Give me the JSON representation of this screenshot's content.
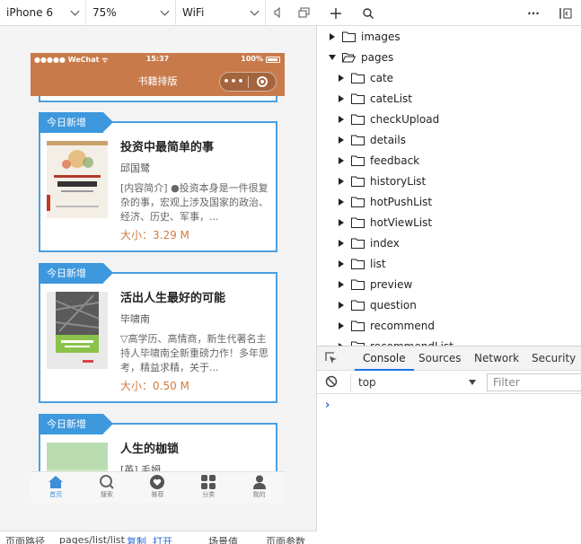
{
  "simulator": {
    "device": "iPhone 6",
    "zoom": "75%",
    "network": "WiFi"
  },
  "phone": {
    "status": {
      "carrier": "●●●●● WeChat ᯤ",
      "time": "15:37",
      "battery": "100%"
    },
    "nav_title": "书籍排版",
    "capsule_dots": "•••"
  },
  "cards": [
    {
      "tag": "今日新增",
      "title": "投资中最简单的事",
      "author": "邱国鹭",
      "desc": "[内容简介] ●投资本身是一件很复杂的事，宏观上涉及国家的政治、经济、历史、军事，...",
      "size": "大小：3.29 M"
    },
    {
      "tag": "今日新增",
      "title": "活出人生最好的可能",
      "author": "毕啸南",
      "desc": "▽高学历、高情商，新生代著名主持人毕啸南全新重磅力作！多年思考，精益求精，关于...",
      "size": "大小：0.50 M"
    },
    {
      "tag": "今日新增",
      "title": "人生的枷锁",
      "author": "[英] 毛姆",
      "desc": "",
      "size": ""
    }
  ],
  "tabbar": [
    {
      "label": "首页",
      "icon": "home-icon",
      "active": true
    },
    {
      "label": "搜索",
      "icon": "search-icon",
      "active": false
    },
    {
      "label": "推荐",
      "icon": "heart-icon",
      "active": false
    },
    {
      "label": "分类",
      "icon": "grid-icon",
      "active": false
    },
    {
      "label": "我的",
      "icon": "person-icon",
      "active": false
    }
  ],
  "bottom_bar": {
    "path_label": "页面路径",
    "path_value": "pages/list/list",
    "copy": "复制",
    "open": "打开",
    "scene": "场景值",
    "params": "页面参数"
  },
  "devtools": {
    "tree": [
      {
        "name": "images",
        "expanded": false,
        "level": 0
      },
      {
        "name": "pages",
        "expanded": true,
        "level": 0
      },
      {
        "name": "cate",
        "expanded": false,
        "level": 1
      },
      {
        "name": "cateList",
        "expanded": false,
        "level": 1
      },
      {
        "name": "checkUpload",
        "expanded": false,
        "level": 1
      },
      {
        "name": "details",
        "expanded": false,
        "level": 1
      },
      {
        "name": "feedback",
        "expanded": false,
        "level": 1
      },
      {
        "name": "historyList",
        "expanded": false,
        "level": 1
      },
      {
        "name": "hotPushList",
        "expanded": false,
        "level": 1
      },
      {
        "name": "hotViewList",
        "expanded": false,
        "level": 1
      },
      {
        "name": "index",
        "expanded": false,
        "level": 1
      },
      {
        "name": "list",
        "expanded": false,
        "level": 1
      },
      {
        "name": "preview",
        "expanded": false,
        "level": 1
      },
      {
        "name": "question",
        "expanded": false,
        "level": 1
      },
      {
        "name": "recommend",
        "expanded": false,
        "level": 1
      },
      {
        "name": "recommendList",
        "expanded": false,
        "level": 1
      }
    ],
    "console_tabs": [
      "Console",
      "Sources",
      "Network",
      "Security"
    ],
    "context": "top",
    "filter_placeholder": "Filter",
    "prompt": "›"
  }
}
